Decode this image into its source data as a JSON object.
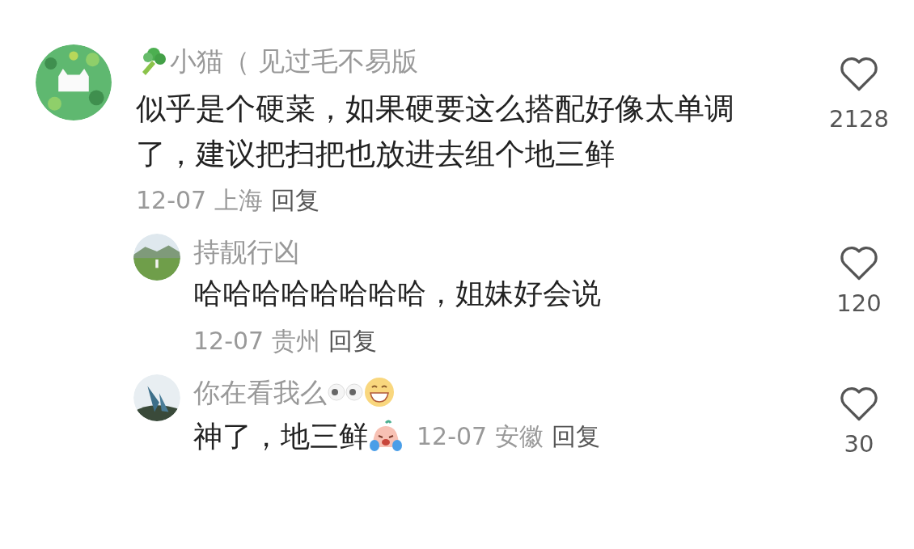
{
  "comments": [
    {
      "name_parts": [
        {
          "kind": "broccoli"
        },
        {
          "kind": "text",
          "text": "小猫（ 见过毛不易版"
        }
      ],
      "text_parts": [
        {
          "kind": "text",
          "text": "似乎是个硬菜，如果硬要这么搭配好像太单调了，建议把扫把也放进去组个地三鲜"
        }
      ],
      "date": "12-07",
      "location": "上海",
      "reply": "回复",
      "likes": "2128",
      "children": [
        {
          "name_parts": [
            {
              "kind": "text",
              "text": "持靓行凶"
            }
          ],
          "text_parts": [
            {
              "kind": "text",
              "text": "哈哈哈哈哈哈哈哈，姐妹好会说"
            }
          ],
          "date": "12-07",
          "location": "贵州",
          "reply": "回复",
          "likes": "120",
          "inline_meta": false
        },
        {
          "name_parts": [
            {
              "kind": "text",
              "text": "你在看我么"
            },
            {
              "kind": "eyes"
            },
            {
              "kind": "grin"
            }
          ],
          "text_parts": [
            {
              "kind": "text",
              "text": "神了，地三鲜"
            },
            {
              "kind": "crying"
            }
          ],
          "date": "12-07",
          "location": "安徽",
          "reply": "回复",
          "likes": "30",
          "inline_meta": true
        }
      ]
    }
  ]
}
